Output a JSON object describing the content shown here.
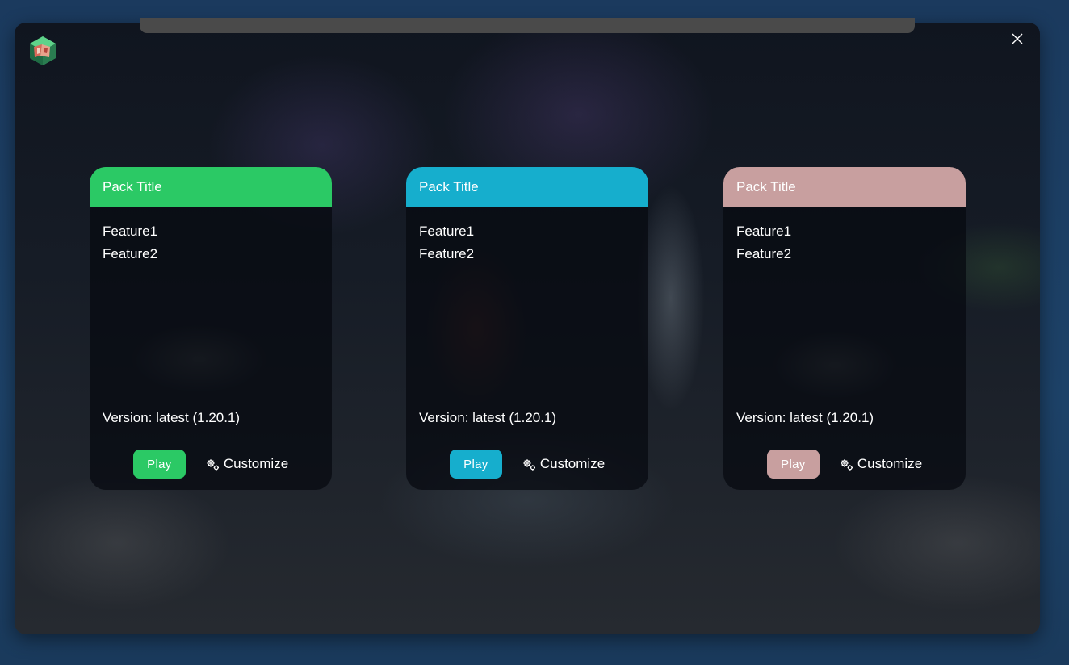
{
  "colors": {
    "green": "#2bc965",
    "cyan": "#16aecd",
    "pink": "#c89f9f"
  },
  "icons": {
    "logo": "cube-logo-icon",
    "close": "close-icon",
    "customize": "gear-icon"
  },
  "packs": [
    {
      "title": "Pack Title",
      "features": [
        "Feature1",
        "Feature2"
      ],
      "version": "Version: latest (1.20.1)",
      "play_label": "Play",
      "customize_label": "Customize",
      "color": "#2bc965"
    },
    {
      "title": "Pack Title",
      "features": [
        "Feature1",
        "Feature2"
      ],
      "version": "Version: latest (1.20.1)",
      "play_label": "Play",
      "customize_label": "Customize",
      "color": "#16aecd"
    },
    {
      "title": "Pack Title",
      "features": [
        "Feature1",
        "Feature2"
      ],
      "version": "Version: latest (1.20.1)",
      "play_label": "Play",
      "customize_label": "Customize",
      "color": "#c89f9f"
    }
  ]
}
